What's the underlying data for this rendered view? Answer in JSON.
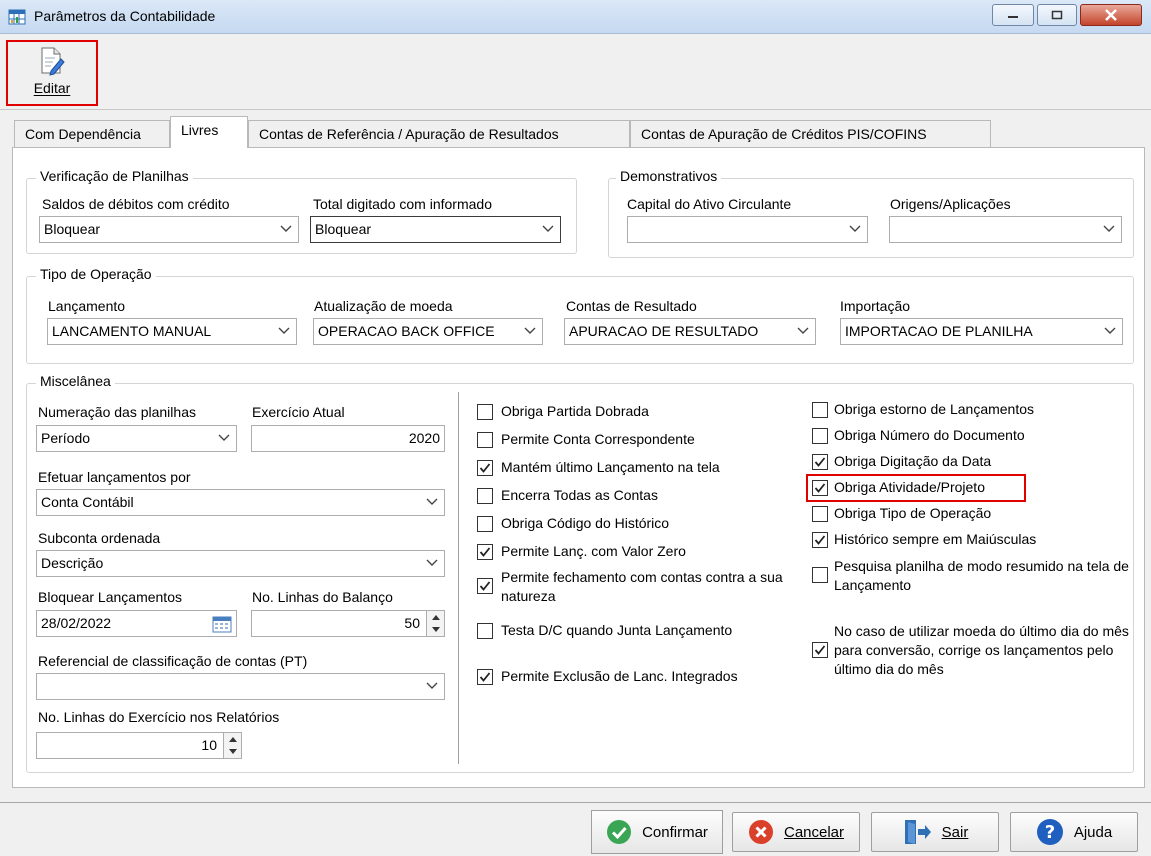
{
  "window": {
    "title": "Parâmetros da Contabilidade"
  },
  "toolbar": {
    "edit_label": "Editar"
  },
  "tabs": [
    {
      "label": "Com Dependência"
    },
    {
      "label": "Livres"
    },
    {
      "label": "Contas de Referência / Apuração de Resultados"
    },
    {
      "label": "Contas de Apuração de Créditos PIS/COFINS"
    }
  ],
  "verificacao": {
    "title": "Verificação de Planilhas",
    "saldos_label": "Saldos de débitos com crédito",
    "saldos_value": "Bloquear",
    "total_label": "Total digitado com informado",
    "total_value": "Bloquear"
  },
  "demonstrativos": {
    "title": "Demonstrativos",
    "capital_label": "Capital do Ativo Circulante",
    "capital_value": "",
    "origens_label": "Origens/Aplicações",
    "origens_value": ""
  },
  "tipo_operacao": {
    "title": "Tipo de Operação",
    "lancamento_label": "Lançamento",
    "lancamento_value": "LANCAMENTO MANUAL",
    "atualizacao_label": "Atualização de moeda",
    "atualizacao_value": "OPERACAO BACK OFFICE",
    "contas_label": "Contas de Resultado",
    "contas_value": "APURACAO DE RESULTADO",
    "importacao_label": "Importação",
    "importacao_value": "IMPORTACAO DE PLANILHA"
  },
  "misc": {
    "title": "Miscelânea",
    "numeracao_label": "Numeração das planilhas",
    "numeracao_value": "Período",
    "exercicio_label": "Exercício Atual",
    "exercicio_value": "2020",
    "efetuar_label": "Efetuar lançamentos por",
    "efetuar_value": "Conta Contábil",
    "subconta_label": "Subconta ordenada",
    "subconta_value": "Descrição",
    "bloquear_label": "Bloquear Lançamentos",
    "bloquear_value": "28/02/2022",
    "linhas_balanco_label": "No. Linhas do Balanço",
    "linhas_balanco_value": "50",
    "referencial_label": "Referencial de classificação de contas (PT)",
    "referencial_value": "",
    "linhas_exercicio_label": "No. Linhas do Exercício nos Relatórios",
    "linhas_exercicio_value": "10"
  },
  "checks_middle": [
    {
      "label": "Obriga Partida Dobrada",
      "checked": false
    },
    {
      "label": "Permite Conta Correspondente",
      "checked": false
    },
    {
      "label": "Mantém último Lançamento na tela",
      "checked": true
    },
    {
      "label": "Encerra Todas as Contas",
      "checked": false
    },
    {
      "label": "Obriga Código do Histórico",
      "checked": false
    },
    {
      "label": "Permite Lanç. com Valor Zero",
      "checked": true
    },
    {
      "label": "Permite fechamento com contas contra a sua natureza",
      "checked": true
    },
    {
      "label": "Testa D/C quando Junta Lançamento",
      "checked": false
    },
    {
      "label": "Permite Exclusão de Lanc. Integrados",
      "checked": true
    }
  ],
  "checks_right": [
    {
      "label": "Obriga estorno de Lançamentos",
      "checked": false
    },
    {
      "label": "Obriga Número do Documento",
      "checked": false
    },
    {
      "label": "Obriga Digitação da Data",
      "checked": true
    },
    {
      "label": "Obriga Atividade/Projeto",
      "checked": true
    },
    {
      "label": "Obriga Tipo de Operação",
      "checked": false
    },
    {
      "label": "Histórico sempre em Maiúsculas",
      "checked": true
    },
    {
      "label": "Pesquisa planilha de modo resumido na tela de Lançamento",
      "checked": false
    },
    {
      "label": "No caso de utilizar moeda do último dia do mês para conversão, corrige os lançamentos pelo último dia do mês",
      "checked": true
    }
  ],
  "footer": {
    "confirm_label": "Confirmar",
    "cancel_label": "Cancelar",
    "exit_label": "Sair",
    "help_label": "Ajuda"
  },
  "colors": {
    "highlight_red": "#e00000",
    "confirm_green": "#3aa655",
    "cancel_red": "#d9412b",
    "help_blue": "#1f5fbf"
  }
}
